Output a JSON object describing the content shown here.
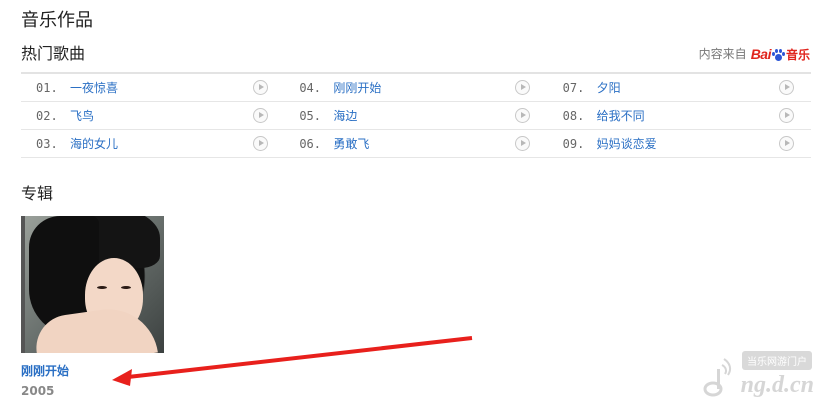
{
  "page": {
    "title": "音乐作品",
    "hot_songs_heading": "热门歌曲",
    "albums_heading": "专辑"
  },
  "source": {
    "label": "内容来自",
    "brand": "Bai",
    "brand_suffix": "音乐"
  },
  "songs": [
    [
      {
        "num": "01.",
        "title": "一夜惊喜"
      },
      {
        "num": "04.",
        "title": "刚刚开始"
      },
      {
        "num": "07.",
        "title": "夕阳"
      }
    ],
    [
      {
        "num": "02.",
        "title": "飞鸟"
      },
      {
        "num": "05.",
        "title": "海边"
      },
      {
        "num": "08.",
        "title": "给我不同"
      }
    ],
    [
      {
        "num": "03.",
        "title": "海的女儿"
      },
      {
        "num": "06.",
        "title": "勇敢飞"
      },
      {
        "num": "09.",
        "title": "妈妈谈恋爱"
      }
    ]
  ],
  "albums": [
    {
      "title": "刚刚开始",
      "year": "2005"
    }
  ],
  "watermark": {
    "badge": "当乐网游门户",
    "logo": "ng.d.cn"
  },
  "colors": {
    "link": "#2a6fc4",
    "arrow": "#e8201c",
    "baidu_red": "#e0251e",
    "baidu_blue": "#2b55d6"
  }
}
